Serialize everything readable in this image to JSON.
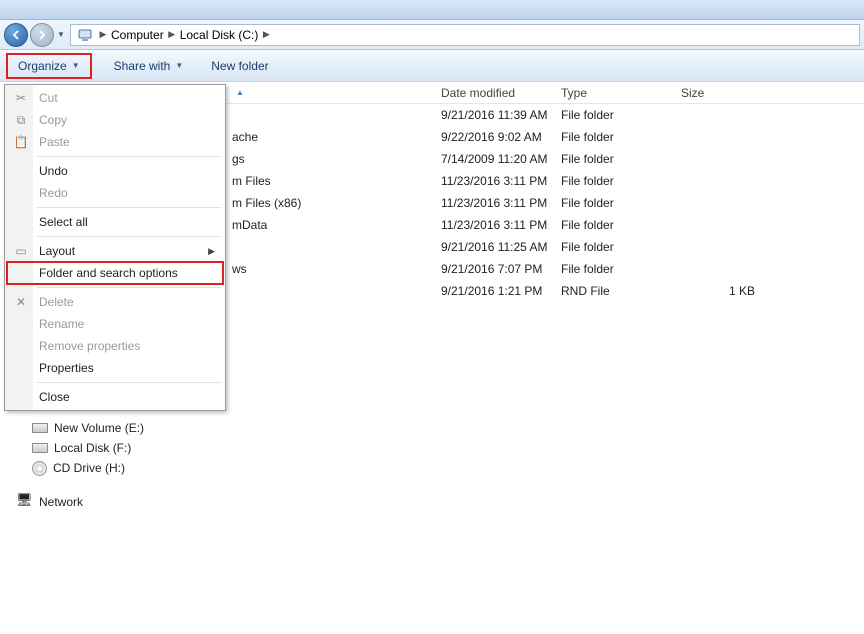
{
  "breadcrumb": {
    "root": "Computer",
    "loc": "Local Disk (C:)"
  },
  "toolbar": {
    "organize": "Organize",
    "share": "Share with",
    "newfolder": "New folder"
  },
  "columns": {
    "date": "Date modified",
    "type": "Type",
    "size": "Size"
  },
  "menu": {
    "cut": "Cut",
    "copy": "Copy",
    "paste": "Paste",
    "undo": "Undo",
    "redo": "Redo",
    "select_all": "Select all",
    "layout": "Layout",
    "folder_options": "Folder and search options",
    "delete": "Delete",
    "rename": "Rename",
    "remove_props": "Remove properties",
    "properties": "Properties",
    "close": "Close"
  },
  "sidebar": {
    "items": [
      {
        "label": "New Volume (E:)",
        "kind": "hd"
      },
      {
        "label": "Local Disk (F:)",
        "kind": "hd"
      },
      {
        "label": "CD Drive (H:)",
        "kind": "cd"
      }
    ],
    "network": "Network"
  },
  "files": [
    {
      "name_tail": "",
      "date": "9/21/2016 11:39 AM",
      "type": "File folder",
      "size": ""
    },
    {
      "name_tail": "ache",
      "date": "9/22/2016 9:02 AM",
      "type": "File folder",
      "size": ""
    },
    {
      "name_tail": "gs",
      "date": "7/14/2009 11:20 AM",
      "type": "File folder",
      "size": ""
    },
    {
      "name_tail": "m Files",
      "date": "11/23/2016 3:11 PM",
      "type": "File folder",
      "size": ""
    },
    {
      "name_tail": "m Files (x86)",
      "date": "11/23/2016 3:11 PM",
      "type": "File folder",
      "size": ""
    },
    {
      "name_tail": "mData",
      "date": "11/23/2016 3:11 PM",
      "type": "File folder",
      "size": ""
    },
    {
      "name_tail": "",
      "date": "9/21/2016 11:25 AM",
      "type": "File folder",
      "size": ""
    },
    {
      "name_tail": "ws",
      "date": "9/21/2016 7:07 PM",
      "type": "File folder",
      "size": ""
    },
    {
      "name_tail": "",
      "date": "9/21/2016 1:21 PM",
      "type": "RND File",
      "size": "1 KB"
    }
  ]
}
